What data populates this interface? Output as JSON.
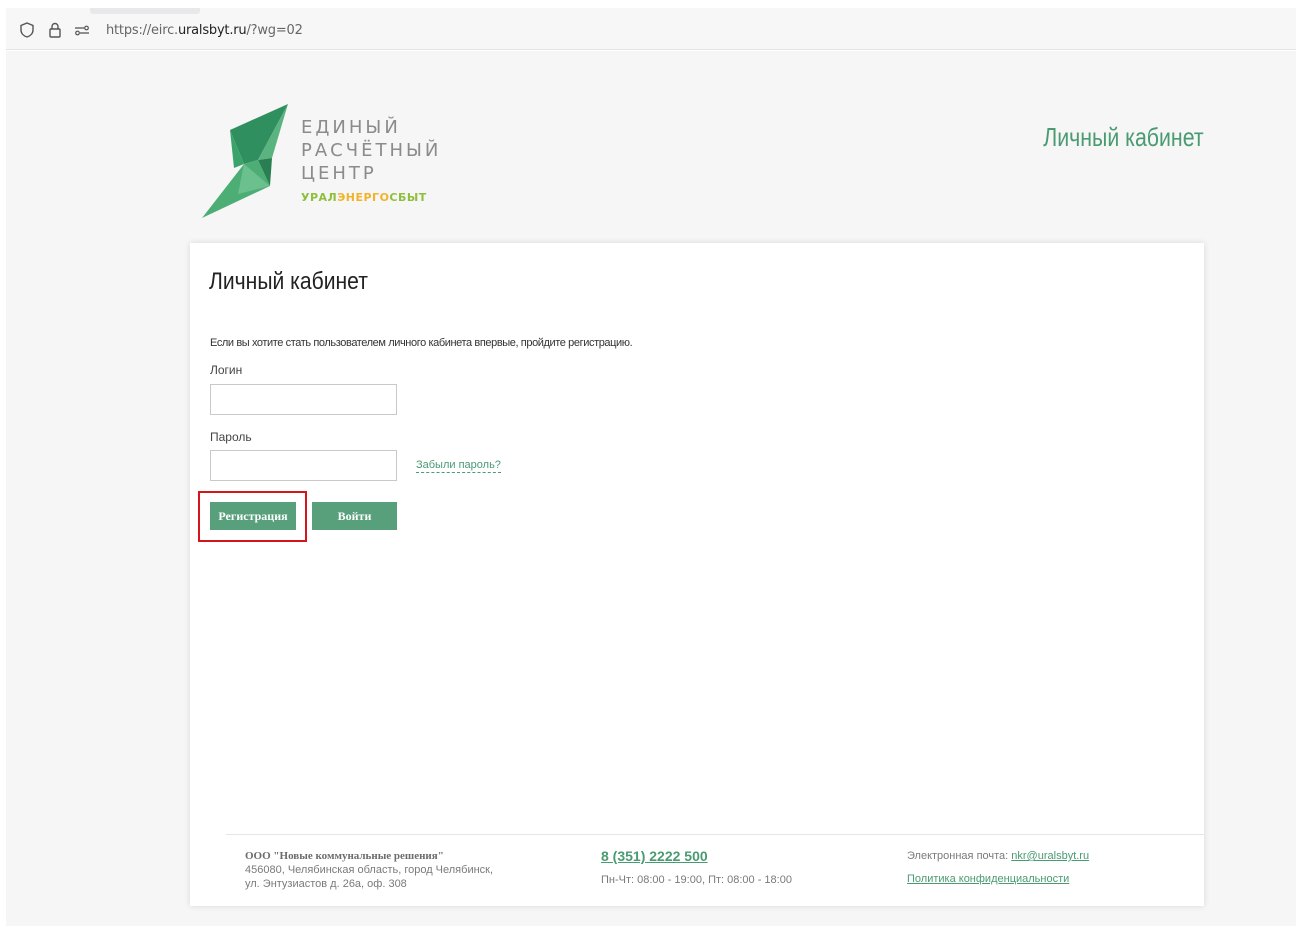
{
  "browser": {
    "url_prefix": "https://eirc.",
    "url_domain": "uralsbyt.ru",
    "url_suffix": "/?wg=02"
  },
  "header": {
    "logo_lines": [
      "ЕДИНЫЙ",
      "РАСЧЁТНЫЙ",
      "ЦЕНТР"
    ],
    "logo_sub_ural": "УРАЛ",
    "logo_sub_energo": "ЭНЕРГО",
    "logo_sub_sbyt": "СБЫТ",
    "title": "Личный кабинет"
  },
  "form": {
    "title": "Личный кабинет",
    "intro": "Если вы хотите стать пользователем личного кабинета впервые, пройдите регистрацию.",
    "login_label": "Логин",
    "login_value": "",
    "password_label": "Пароль",
    "password_value": "",
    "forgot_label": "Забыли пароль?",
    "register_label": "Регистрация",
    "login_button_label": "Войти"
  },
  "footer": {
    "company_name": "ООО \"Новые коммунальные решения\"",
    "address_line1": "456080, Челябинская область, город Челябинск,",
    "address_line2": "ул. Энтузиастов д. 26а, оф. 308",
    "phone": "8 (351) 2222 500",
    "hours": "Пн-Чт: 08:00 - 19:00, Пт: 08:00 - 18:00",
    "email_label": "Электронная почта:",
    "email": "nkr@uralsbyt.ru",
    "privacy": "Политика конфиденциальности"
  },
  "colors": {
    "brand_green": "#58a07c",
    "highlight_red": "#d4161c"
  }
}
